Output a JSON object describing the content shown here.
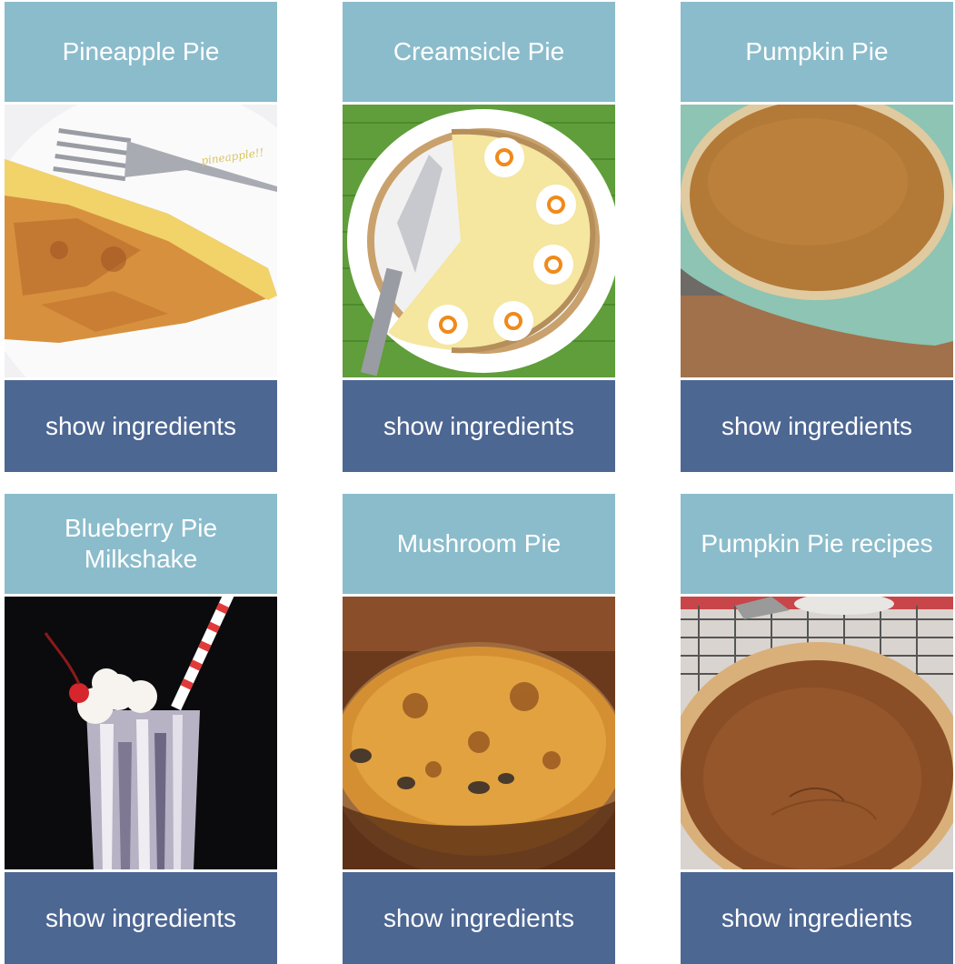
{
  "cards": [
    {
      "title": "Pineapple Pie",
      "image": "pineapple-pie-photo",
      "button_label": "show ingredients",
      "watermark": "pineapple!!"
    },
    {
      "title": "Creamsicle Pie",
      "image": "creamsicle-pie-photo",
      "button_label": "show ingredients"
    },
    {
      "title": "Pumpkin Pie",
      "image": "pumpkin-pie-photo",
      "button_label": "show ingredients"
    },
    {
      "title": "Blueberry Pie Milkshake",
      "image": "blueberry-pie-milkshake-photo",
      "button_label": "show ingredients"
    },
    {
      "title": "Mushroom Pie",
      "image": "mushroom-pie-photo",
      "button_label": "show ingredients"
    },
    {
      "title": "Pumpkin Pie recipes",
      "image": "pumpkin-pie-recipes-photo",
      "button_label": "show ingredients"
    }
  ],
  "colors": {
    "title_bg": "#8bbccb",
    "button_bg": "#4d6793",
    "text": "#ffffff"
  }
}
